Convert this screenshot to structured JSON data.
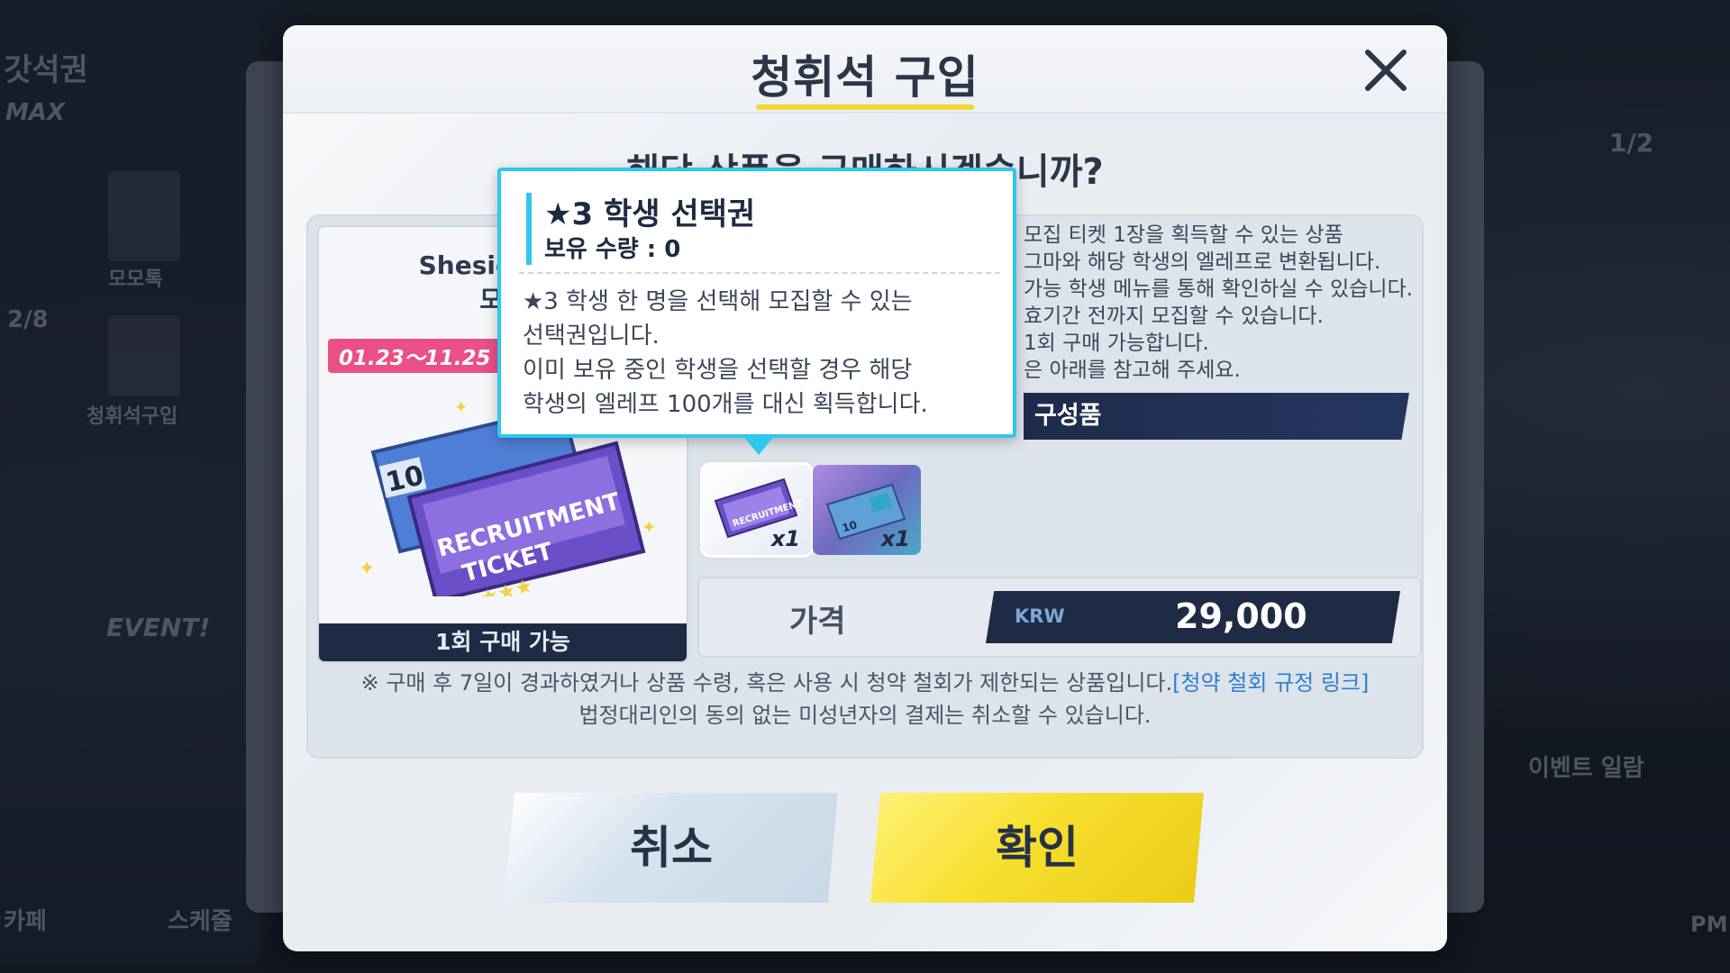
{
  "background": {
    "left_texts": [
      "갓석권",
      "MAX",
      "2/8",
      "모모톡",
      "청휘석구입",
      "EVENT!",
      "카페",
      "스케줄"
    ],
    "right_texts": [
      "1/2",
      "이벤트 일람",
      "PM"
    ]
  },
  "modal": {
    "title": "청휘석 구입",
    "question": "해당 상품을 구매하시겠습니까?",
    "product": {
      "name_line1": "Sheside out",
      "name_line2": "모집",
      "date_range": "01.23～11.25",
      "ticket_text": "RECRUITMENT TICKET",
      "ticket_number": "10",
      "purchase_limit": "1회 구매 가능"
    },
    "description": [
      "모집 티켓 1장을 획득할 수 있는 상품",
      "그마와 해당 학생의 엘레프로 변환됩니다.",
      "가능 학생 메뉴를 통해 확인하실 수 있습니다.",
      "효기간 전까지 모집할 수 있습니다.",
      "1회 구매 가능합니다.",
      "은 아래를 참고해 주세요."
    ],
    "contents_label": "구성품",
    "items": [
      {
        "icon": "recruitment-ticket-icon",
        "qty": "x1"
      },
      {
        "icon": "ten-ticket-icon",
        "qty": "x1"
      }
    ],
    "price": {
      "label": "가격",
      "currency": "KRW",
      "value": "29,000"
    },
    "notice_line1": "※ 구매 후 7일이 경과하였거나 상품 수령, 혹은 사용 시 청약 철회가 제한되는 상품입니다.",
    "notice_link": "[청약 철회 규정 링크]",
    "notice_line2": "법정대리인의 동의 없는 미성년자의 결제는 취소할 수 있습니다.",
    "cancel_label": "취소",
    "confirm_label": "확인"
  },
  "tooltip": {
    "title": "★3 학생 선택권",
    "count": "보유 수량 : 0",
    "desc_line1": "★3 학생 한 명을 선택해 모집할 수 있는",
    "desc_line2": "선택권입니다.",
    "desc_line3": "이미 보유 중인 학생을 선택할 경우 해당",
    "desc_line4": "학생의 엘레프 100개를 대신 획득합니다."
  },
  "colors": {
    "accent_cyan": "#2fc8ec",
    "confirm_yellow": "#f7df2e",
    "navy": "#1f2b44",
    "date_pink": "#ea4f85",
    "link_blue": "#2f7fd0"
  }
}
